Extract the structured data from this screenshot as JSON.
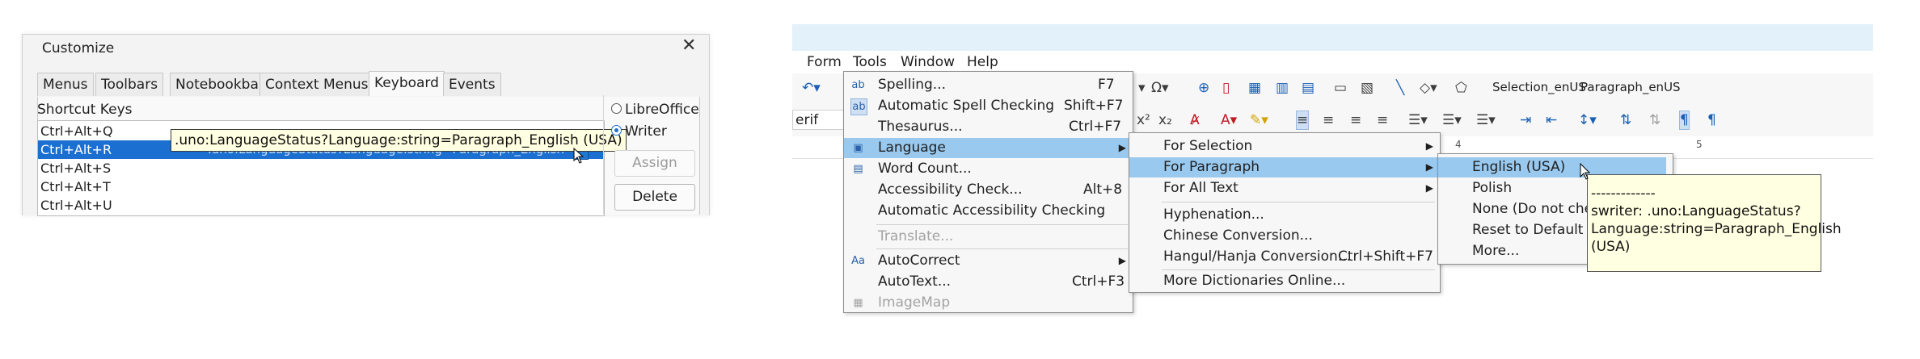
{
  "dialog": {
    "title": "Customize",
    "close_glyph": "✕",
    "tabs": [
      "Menus",
      "Toolbars",
      "Notebookbar",
      "Context Menus",
      "Keyboard",
      "Events"
    ],
    "active_tab": "Keyboard",
    "shortcut_keys_label": "Shortcut Keys",
    "shortcuts": [
      {
        "keys": "Ctrl+Alt+Q",
        "function": ""
      },
      {
        "keys": "Ctrl+Alt+R",
        "function": ".uno:LanguageStatus?Language:string=Paragraph_English"
      },
      {
        "keys": "Ctrl+Alt+S",
        "function": ""
      },
      {
        "keys": "Ctrl+Alt+T",
        "function": ""
      },
      {
        "keys": "Ctrl+Alt+U",
        "function": ""
      }
    ],
    "tooltip": ".uno:LanguageStatus?Language:string=Paragraph_English (USA)",
    "radio_libreoffice": "LibreOffice",
    "radio_writer": "Writer",
    "assign_button": "Assign",
    "delete_button": "Delete"
  },
  "writer": {
    "menubar": [
      "Form",
      "Tools",
      "Window",
      "Help"
    ],
    "paragraph_style": "erif",
    "selection_language": "Selection_enUS",
    "paragraph_language": "Paragraph_enUS",
    "ruler_marks": [
      "4",
      "5"
    ],
    "tools_menu": [
      {
        "label": "Spelling...",
        "accel": "F7",
        "icon": "ab",
        "state": "normal"
      },
      {
        "label": "Automatic Spell Checking",
        "accel": "Shift+F7",
        "icon": "ab",
        "state": "normal"
      },
      {
        "label": "Thesaurus...",
        "accel": "Ctrl+F7",
        "icon": "",
        "state": "normal"
      },
      {
        "label": "Language",
        "accel": "",
        "icon": "lang",
        "state": "highlight",
        "submenu": true
      },
      {
        "label": "Word Count...",
        "accel": "",
        "icon": "wc",
        "state": "normal"
      },
      {
        "label": "Accessibility Check...",
        "accel": "Alt+8",
        "icon": "",
        "state": "normal"
      },
      {
        "label": "Automatic Accessibility Checking",
        "accel": "",
        "icon": "",
        "state": "normal"
      },
      {
        "label": "Translate...",
        "accel": "",
        "icon": "",
        "state": "disabled"
      },
      {
        "label": "AutoCorrect",
        "accel": "",
        "icon": "Aa",
        "state": "normal",
        "submenu": true
      },
      {
        "label": "AutoText...",
        "accel": "Ctrl+F3",
        "icon": "",
        "state": "normal"
      },
      {
        "label": "ImageMap",
        "accel": "",
        "icon": "img",
        "state": "disabled"
      }
    ],
    "language_menu": [
      {
        "label": "For Selection",
        "accel": "",
        "submenu": true,
        "state": "normal"
      },
      {
        "label": "For Paragraph",
        "accel": "",
        "submenu": true,
        "state": "highlight"
      },
      {
        "label": "For All Text",
        "accel": "",
        "submenu": true,
        "state": "normal"
      },
      {
        "label": "Hyphenation...",
        "accel": "",
        "state": "normal"
      },
      {
        "label": "Chinese Conversion...",
        "accel": "",
        "state": "normal"
      },
      {
        "label": "Hangul/Hanja Conversion...",
        "accel": "Ctrl+Shift+F7",
        "state": "normal"
      },
      {
        "label": "More Dictionaries Online...",
        "accel": "",
        "state": "normal"
      }
    ],
    "paragraph_menu": [
      {
        "label": "English (USA)",
        "state": "highlight"
      },
      {
        "label": "Polish",
        "state": "normal"
      },
      {
        "label": "None (Do not che",
        "state": "normal"
      },
      {
        "label": "Reset to Default L",
        "state": "normal"
      },
      {
        "label": "More...",
        "state": "normal"
      }
    ],
    "tooltip_lines": [
      "-------------",
      "swriter: .uno:LanguageStatus?",
      "Language:string=Paragraph_English",
      "(USA)"
    ]
  }
}
